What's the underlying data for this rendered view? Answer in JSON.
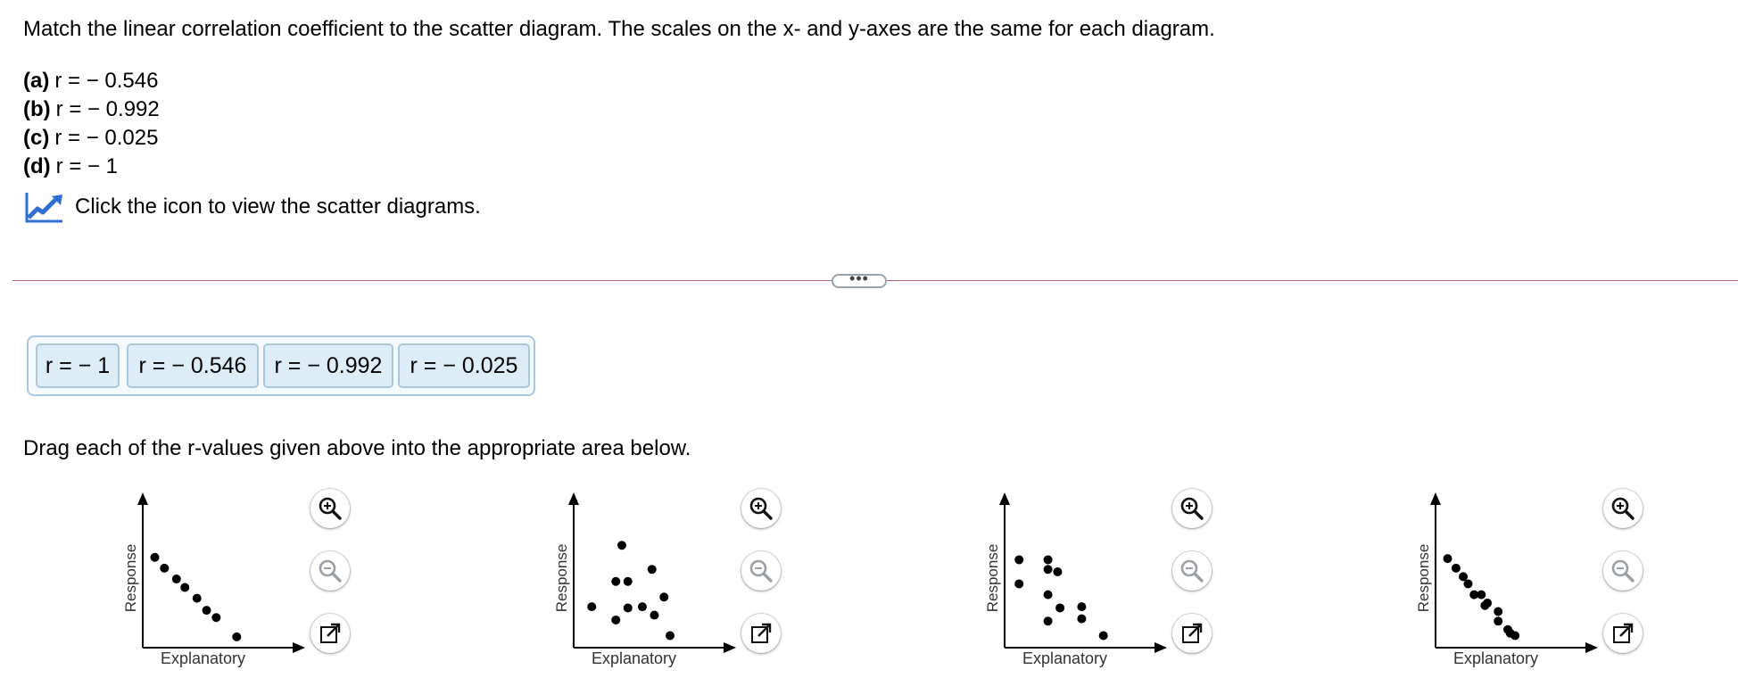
{
  "question": {
    "instruction": "Match the linear correlation coefficient to the scatter diagram. The scales on the x- and y-axes are the same for each diagram.",
    "choices": [
      {
        "letter": "(a)",
        "text": "r = − 0.546"
      },
      {
        "letter": "(b)",
        "text": "r = − 0.992"
      },
      {
        "letter": "(c)",
        "text": "r = − 0.025"
      },
      {
        "letter": "(d)",
        "text": "r = − 1"
      }
    ],
    "icon_link_text": "Click the icon to view the scatter diagrams.",
    "icon_name": "chart-trend-icon"
  },
  "divider": {
    "more_label": "•••"
  },
  "tray": {
    "tiles": [
      "r = − 1",
      "r = − 0.546",
      "r = − 0.992",
      "r = − 0.025"
    ]
  },
  "drag_instruction": "Drag each of the r-values given above into the appropriate area below.",
  "tools": {
    "zoom_in_icon": "zoom-in-icon",
    "zoom_out_icon": "zoom-out-icon",
    "popout_icon": "popout-icon"
  },
  "chart_data": [
    {
      "type": "scatter",
      "xlabel": "Explanatory",
      "ylabel": "Response",
      "grid": false,
      "points": [
        [
          1,
          7.5
        ],
        [
          1.8,
          6.6
        ],
        [
          2.8,
          5.7
        ],
        [
          3.5,
          5.0
        ],
        [
          4.5,
          4.1
        ],
        [
          5.3,
          3.1
        ],
        [
          6.1,
          2.5
        ],
        [
          7.8,
          0.9
        ]
      ]
    },
    {
      "type": "scatter",
      "xlabel": "Explanatory",
      "ylabel": "Response",
      "grid": false,
      "points": [
        [
          4.0,
          8.5
        ],
        [
          3.5,
          5.5
        ],
        [
          4.5,
          5.5
        ],
        [
          6.5,
          6.5
        ],
        [
          7.5,
          4.2
        ],
        [
          1.5,
          3.4
        ],
        [
          4.5,
          3.3
        ],
        [
          5.7,
          3.4
        ],
        [
          3.5,
          2.3
        ],
        [
          6.7,
          2.7
        ],
        [
          8.0,
          1.0
        ]
      ]
    },
    {
      "type": "scatter",
      "xlabel": "Explanatory",
      "ylabel": "Response",
      "grid": false,
      "points": [
        [
          1.2,
          7.3
        ],
        [
          3.6,
          7.3
        ],
        [
          3.6,
          6.5
        ],
        [
          4.4,
          6.3
        ],
        [
          1.2,
          5.3
        ],
        [
          3.6,
          4.4
        ],
        [
          4.6,
          3.3
        ],
        [
          6.4,
          3.4
        ],
        [
          6.4,
          2.4
        ],
        [
          3.6,
          2.2
        ],
        [
          8.2,
          1.0
        ]
      ]
    },
    {
      "type": "scatter",
      "xlabel": "Explanatory",
      "ylabel": "Response",
      "grid": false,
      "points": [
        [
          1,
          7.4
        ],
        [
          1.7,
          6.6
        ],
        [
          2.3,
          5.9
        ],
        [
          2.7,
          5.3
        ],
        [
          3.2,
          4.4
        ],
        [
          3.8,
          4.4
        ],
        [
          4.3,
          3.7
        ],
        [
          4.1,
          3.5
        ],
        [
          5.2,
          3.0
        ],
        [
          5.2,
          2.2
        ],
        [
          6.0,
          1.5
        ],
        [
          6.6,
          1.0
        ],
        [
          6.2,
          1.2
        ]
      ]
    }
  ]
}
